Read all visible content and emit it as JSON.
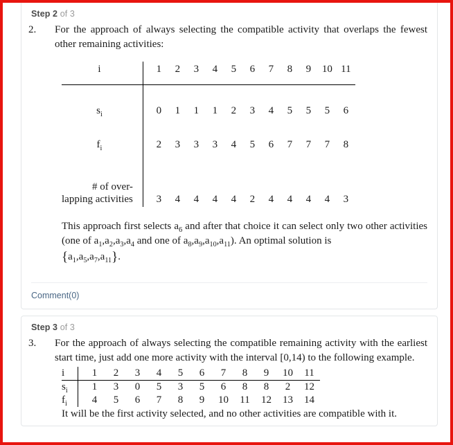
{
  "steps": [
    {
      "header_strong": "Step 2",
      "header_rest": " of 3",
      "item_number": "2.",
      "intro": "For the approach of always selecting the compatible activity that overlaps the fewest other remaining activities:",
      "table": {
        "row_labels": {
          "index": "i",
          "start": "s",
          "start_sub": "i",
          "finish": "f",
          "finish_sub": "i",
          "overlap_line1": "# of over-",
          "overlap_line2": "lapping activities"
        },
        "index": [
          "1",
          "2",
          "3",
          "4",
          "5",
          "6",
          "7",
          "8",
          "9",
          "10",
          "11"
        ],
        "s": [
          "0",
          "1",
          "1",
          "1",
          "2",
          "3",
          "4",
          "5",
          "5",
          "5",
          "6"
        ],
        "f": [
          "2",
          "3",
          "3",
          "3",
          "4",
          "5",
          "6",
          "7",
          "7",
          "7",
          "8"
        ],
        "overlaps": [
          "3",
          "4",
          "4",
          "4",
          "4",
          "2",
          "4",
          "4",
          "4",
          "4",
          "3"
        ]
      },
      "conclusion_parts": {
        "p1": "This approach first selects ",
        "a6": "a",
        "a6sub": "6",
        "p2": " and after that choice it can select only two other activities (one of ",
        "set1": "a",
        "p3": "). An optimal solution is",
        "p4": "."
      },
      "conclusion_set1": [
        "1",
        "2",
        "3",
        "4"
      ],
      "conclusion_set2": [
        "8",
        "9",
        "10",
        "11"
      ],
      "conclusion_mid": " and one of ",
      "optimal_set": [
        "1",
        "5",
        "7",
        "11"
      ],
      "comment_label": "Comment(0)"
    },
    {
      "header_strong": "Step 3",
      "header_rest": " of 3",
      "item_number": "3.",
      "intro": "For the approach of always selecting the compatible remaining activity with the earliest start time, just add one more activity with the interval [0,14) to the following example.",
      "table": {
        "row_labels": {
          "index": "i",
          "start": "s",
          "start_sub": "i",
          "finish": "f",
          "finish_sub": "i"
        },
        "index": [
          "1",
          "2",
          "3",
          "4",
          "5",
          "6",
          "7",
          "8",
          "9",
          "10",
          "11"
        ],
        "s": [
          "1",
          "3",
          "0",
          "5",
          "3",
          "5",
          "6",
          "8",
          "8",
          "2",
          "12"
        ],
        "f": [
          "4",
          "5",
          "6",
          "7",
          "8",
          "9",
          "10",
          "11",
          "12",
          "13",
          "14"
        ]
      },
      "outro": "It will be the first activity selected, and no other activities are compatible with it."
    }
  ],
  "colors": {
    "page_border": "#e8150f",
    "card_border": "#e3e6e8",
    "header_strong": "#4a4a4a",
    "header_rest": "#9b9b9b",
    "link": "#4a6785",
    "text": "#1a1a1a"
  }
}
